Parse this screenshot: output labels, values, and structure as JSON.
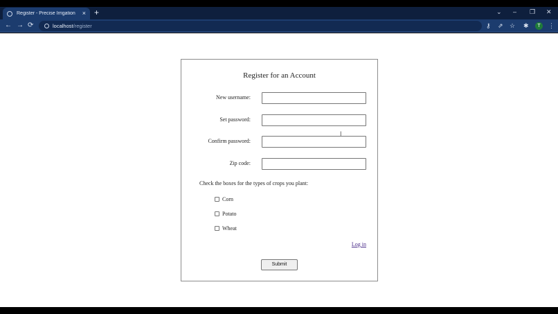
{
  "browser": {
    "tab": {
      "title": "Register - Precise Irrigation"
    },
    "url": {
      "host": "localhost",
      "path": "/register"
    },
    "profile_initial": "T",
    "icons": {
      "newtab": "+",
      "close_tab": "×",
      "back": "←",
      "forward": "→",
      "reload": "⟳",
      "tab_search": "⌄",
      "minimize": "–",
      "restore": "❐",
      "close_window": "✕",
      "key": "⚷",
      "share": "⇗",
      "star": "☆",
      "extensions": "✱",
      "menu": "⋮"
    }
  },
  "form": {
    "title": "Register for an Account",
    "fields": [
      {
        "label": "New username:",
        "value": ""
      },
      {
        "label": "Set password:",
        "value": ""
      },
      {
        "label": "Confirm password:",
        "value": ""
      },
      {
        "label": "Zip code:",
        "value": ""
      }
    ],
    "crops_prompt": "Check the boxes for the types of crops you plant:",
    "crops": [
      {
        "label": "Corn",
        "checked": false
      },
      {
        "label": "Potato",
        "checked": false
      },
      {
        "label": "Wheat",
        "checked": false
      }
    ],
    "login_link": "Log in",
    "submit_label": "Submit"
  }
}
